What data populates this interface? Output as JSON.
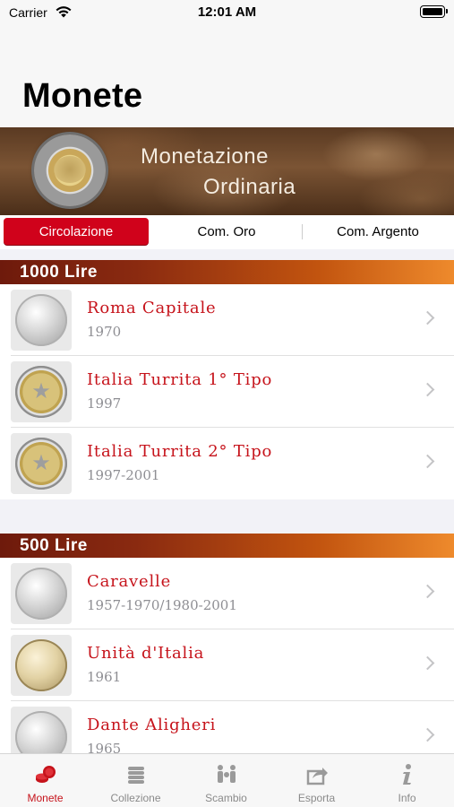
{
  "status": {
    "carrier": "Carrier",
    "time": "12:01 AM"
  },
  "title": "Monete",
  "banner": {
    "line1": "Monetazione",
    "line2": "Ordinaria"
  },
  "segments": [
    "Circolazione",
    "Com. Oro",
    "Com. Argento"
  ],
  "sections": [
    {
      "header": "1000 Lire",
      "items": [
        {
          "title": "Roma Capitale",
          "subtitle": "1970"
        },
        {
          "title": "Italia Turrita 1° Tipo",
          "subtitle": "1997"
        },
        {
          "title": "Italia Turrita 2° Tipo",
          "subtitle": "1997-2001"
        }
      ]
    },
    {
      "header": "500 Lire",
      "items": [
        {
          "title": "Caravelle",
          "subtitle": "1957-1970/1980-2001"
        },
        {
          "title": "Unità d'Italia",
          "subtitle": "1961"
        },
        {
          "title": "Dante Aligheri",
          "subtitle": "1965"
        }
      ]
    }
  ],
  "tabs": [
    {
      "label": "Monete",
      "icon": "coins-icon"
    },
    {
      "label": "Collezione",
      "icon": "coin-stack-icon"
    },
    {
      "label": "Scambio",
      "icon": "exchange-people-icon"
    },
    {
      "label": "Esporta",
      "icon": "share-icon"
    },
    {
      "label": "Info",
      "icon": "info-icon"
    }
  ],
  "colors": {
    "accent": "#c6131b",
    "segment_active": "#d0021b"
  }
}
